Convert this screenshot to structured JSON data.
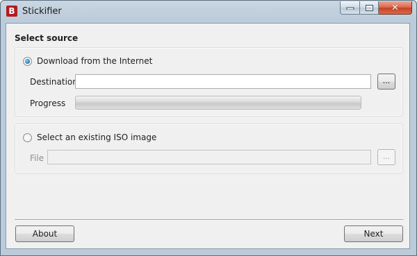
{
  "window": {
    "app_icon_letter": "B",
    "title": "Stickifier",
    "close_glyph": "✕"
  },
  "main": {
    "heading": "Select source",
    "download": {
      "radio_label": "Download from the Internet",
      "selected": true,
      "destination_label": "Destination",
      "destination_value": "",
      "browse_label": "...",
      "progress_label": "Progress",
      "progress_value": 0
    },
    "iso": {
      "radio_label": "Select an existing ISO image",
      "selected": false,
      "file_label": "File",
      "file_value": "",
      "browse_label": "..."
    }
  },
  "footer": {
    "about_label": "About",
    "next_label": "Next"
  },
  "colors": {
    "accent": "#1e6fae",
    "close_button": "#c7401f",
    "app_icon": "#b11d1d"
  }
}
